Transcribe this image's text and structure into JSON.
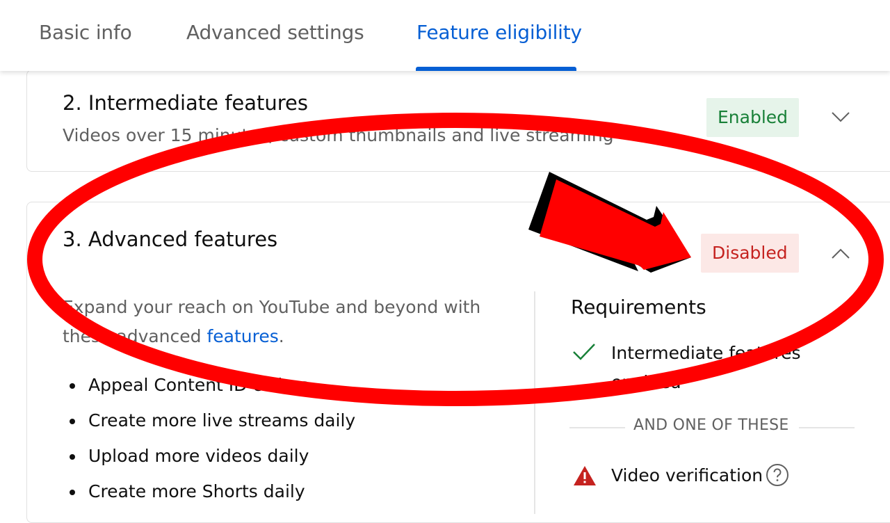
{
  "tabs": [
    {
      "label": "Basic info",
      "active": false
    },
    {
      "label": "Advanced settings",
      "active": false
    },
    {
      "label": "Feature eligibility",
      "active": true
    }
  ],
  "intermediate": {
    "title": "2. Intermediate features",
    "subtitle": "Videos over 15 minutes, custom thumbnails and live streaming",
    "status": "Enabled",
    "expanded": false
  },
  "advanced": {
    "title": "3. Advanced features",
    "status": "Disabled",
    "expanded": true,
    "description_prefix": "Expand your reach on YouTube and beyond with these advanced ",
    "description_link": "features",
    "description_suffix": ".",
    "benefits": [
      "Appeal Content ID claims",
      "Create more live streams daily",
      "Upload more videos daily",
      "Create more Shorts daily"
    ],
    "requirements": {
      "title": "Requirements",
      "met_item": "Intermediate features enabled",
      "separator": "AND ONE OF THESE",
      "options": [
        {
          "label": "Video verification",
          "status_icon": "warning-icon",
          "help_icon": "help-circle-icon"
        }
      ]
    }
  },
  "colors": {
    "accent": "#065fd4",
    "enabled_text": "#188038",
    "enabled_bg": "#e6f4ea",
    "disabled_text": "#c5221f",
    "disabled_bg": "#fce8e6",
    "annotation_red": "#ff0000"
  }
}
